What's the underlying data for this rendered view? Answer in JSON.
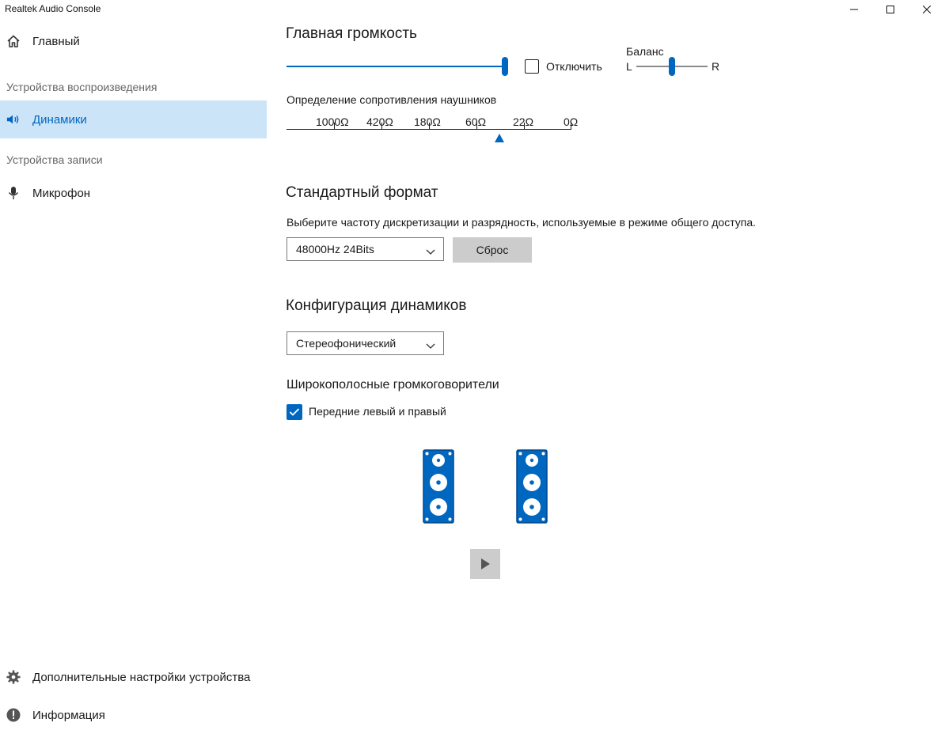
{
  "window": {
    "title": "Realtek Audio Console",
    "controls": [
      "minimize-icon",
      "maximize-icon",
      "close-icon"
    ]
  },
  "sidebar": {
    "home": {
      "label": "Главный",
      "icon": "home-icon"
    },
    "playback_header": "Устройства воспроизведения",
    "speakers": {
      "label": "Динамики",
      "icon": "speaker-icon",
      "active": true
    },
    "recording_header": "Устройства записи",
    "microphone": {
      "label": "Микрофон",
      "icon": "microphone-icon"
    },
    "advanced": {
      "label": "Дополнительные настройки устройства",
      "icon": "gear-icon"
    },
    "info": {
      "label": "Информация",
      "icon": "info-icon"
    }
  },
  "main_volume": {
    "title": "Главная громкость",
    "level_percent": 100,
    "mute_label": "Отключить",
    "mute_checked": false,
    "balance_label": "Баланс",
    "balance_left": "L",
    "balance_right": "R",
    "balance_value": 0
  },
  "impedance": {
    "title": "Определение сопротивления наушников",
    "ticks": [
      "1000Ω",
      "420Ω",
      "180Ω",
      "60Ω",
      "22Ω",
      "0Ω"
    ]
  },
  "default_format": {
    "title": "Стандартный формат",
    "description": "Выберите частоту дискретизации и разрядность, используемые в режиме общего доступа.",
    "selected": "48000Hz 24Bits",
    "reset_label": "Сброс"
  },
  "speaker_config": {
    "title": "Конфигурация динамиков",
    "selected": "Стереофонический",
    "fullrange_title": "Широкополосные громкоговорители",
    "front_lr_label": "Передние левый и правый",
    "front_lr_checked": true,
    "play_icon": "play-icon"
  },
  "colors": {
    "accent": "#0067c0",
    "active_bg": "#cce4f7",
    "button_gray": "#cccccc"
  }
}
